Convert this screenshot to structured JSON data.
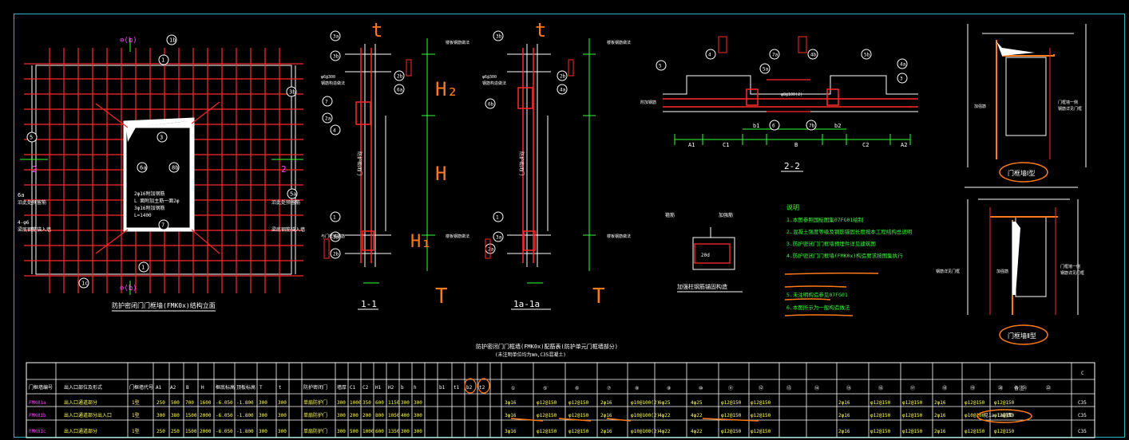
{
  "colors": {
    "background": "#000000",
    "frame": "#29b8c2",
    "rebar": "#ff2a2a",
    "dimension": "#33ff33",
    "highlight": "#ff7a1a",
    "label": "#ffffff",
    "magenta": "#ff44ff",
    "yellow": "#ffff55"
  },
  "elevation": {
    "title": "防护密闭门门框墙(FMK0x)结构立面",
    "labels": {
      "top": "1b",
      "left_mark": "5",
      "right_mark": "3b",
      "c1": "1",
      "c2": "3",
      "c3": "6a",
      "c4": "8b",
      "c5": "7",
      "c6": "4a",
      "c7": "4b",
      "c8": "5a",
      "c9": "7",
      "bottom": "1c"
    },
    "scale_top": "⊙(b)",
    "scale_bottom": "⊙(b)",
    "section_mark": "2",
    "notes": [
      "2φ16附加钢筋",
      "L 面附加主筋一面2φ",
      "3φ16附加钢筋",
      "L=1400"
    ],
    "side_notes": [
      "6a",
      "沿此处预留筋",
      "4-φ6",
      "梁底钢筋锚入墙"
    ]
  },
  "section11": {
    "title": "1-1",
    "handwritten": {
      "t": "t",
      "h2": "H₂",
      "h": "H",
      "h1": "H₁",
      "T": "T"
    },
    "labels": [
      "3a",
      "3b",
      "2b",
      "6a",
      "7",
      "2a",
      "4",
      "1",
      "3a",
      "2b"
    ],
    "notes": [
      "φ6@300",
      "钢筋构造做法",
      "与门框墙钢筋",
      "附加箍筋",
      "6a",
      "竖向钢筋",
      "纵向钢筋"
    ],
    "right_notes": [
      "楼板钢筋做法",
      "防护密闭门",
      "楼板钢筋做法"
    ]
  },
  "section1a": {
    "title": "1a-1a",
    "handwritten": {
      "t": "t",
      "T": "T"
    },
    "labels": [
      "3b",
      "2b",
      "4a",
      "6b",
      "1",
      "3a",
      "2a"
    ],
    "notes": [
      "φ6@300",
      "钢筋构造做法"
    ],
    "right_notes": [
      "楼板钢筋做法",
      "防护密闭门",
      "楼板钢筋做法"
    ]
  },
  "section22": {
    "title": "2-2",
    "labels": [
      "5",
      "4",
      "7a",
      "5a",
      "4b",
      "5b",
      "4a",
      "6",
      "7b",
      "3"
    ],
    "dims": [
      "A1",
      "C1",
      "b1",
      "B",
      "b2",
      "C2",
      "A2"
    ],
    "notes": [
      "φ8@100(2)",
      "附加钢筋"
    ]
  },
  "detail": {
    "title": "加强柱钢筋锚固构造",
    "labels": [
      "箍筋",
      "加强筋",
      "20d"
    ]
  },
  "notes": {
    "heading": "说明",
    "items": [
      "1.本图参照国标图集07FG01绘制",
      "2.混凝土强度等级及钢筋锚固长度按本工程结构总说明",
      "3.防护密闭门门框墙预埋件详见建筑图",
      "4.防护密闭门门框墙(FMK0x)构造要求按图集执行",
      "5.未注明构造参见07FG01",
      "6.本图所示为一般构造做法"
    ]
  },
  "types": {
    "type1": "门框墙Ⅰ型",
    "type2": "门框墙Ⅱ型",
    "labels": [
      "门框墙一侧",
      "钢筋详见门框",
      "加强筋"
    ]
  },
  "table": {
    "title": "防护密闭门门框墙(FMK0x)配筋表(防护单元门框墙部分)",
    "subtitle": "(未注明单位均为mm,C35混凝土)",
    "headers": [
      "门框墙编号",
      "出入口部位及形式",
      "门框墙代号",
      "A1",
      "A2",
      "B",
      "H",
      "框底标高",
      "顶板标高",
      "T",
      "t",
      "防护密闭门",
      "墙厚",
      "C1",
      "C2",
      "H1",
      "H2",
      "b",
      "h",
      "b1",
      "t1",
      "b2",
      "t2",
      "①",
      "⑤",
      "⑥",
      "⑦",
      "⑧",
      "⑨",
      "⑩",
      "⑪",
      "⑫",
      "⑬",
      "⑭",
      "⑮",
      "⑯",
      "⑰",
      "⑱",
      "⑲",
      "⑳",
      "㉑",
      "㉒",
      "备注",
      "C"
    ],
    "rows": [
      {
        "id": "FMK01a",
        "desc": "出入口通道部分",
        "code": "1型",
        "A1": "250",
        "A2": "500",
        "B": "700",
        "H": "1600",
        "bot": "-6.050",
        "top": "-1.800",
        "T": "300",
        "t": "300",
        "door": "单扇防护门",
        "w": "300",
        "C1": "1000",
        "C2": "350",
        "H1": "600",
        "H2": "1150",
        "b": "300",
        "h": "300",
        "r1": "3φ16",
        "r2": "φ12@150",
        "r3": "φ12@150",
        "r4": "2φ16",
        "r5": "φ10@100(2)",
        "r6": "6φ25",
        "r7": "4φ25",
        "r8": "φ12@150",
        "r9": "φ12@150",
        "r10": "2φ16",
        "r11": "φ12@150",
        "r12": "φ12@150",
        "r13": "2φ16",
        "r14": "φ12@150",
        "r15": "φ12@150",
        "note": "",
        "c": "C35"
      },
      {
        "id": "FMK01b",
        "desc": "出入口通道部分出入口",
        "code": "1型",
        "A1": "300",
        "A2": "380",
        "B": "1500",
        "H": "2000",
        "bot": "-6.050",
        "top": "-1.800",
        "T": "300",
        "t": "300",
        "door": "单扇防护门",
        "w": "300",
        "C1": "200",
        "C2": "200",
        "H1": "800",
        "H2": "1050",
        "b": "400",
        "h": "300",
        "r1": "3φ16",
        "r2": "φ12@150",
        "r3": "φ12@150",
        "r4": "2φ16",
        "r5": "φ10@100(2)",
        "r6": "4φ22",
        "r7": "4φ22",
        "r8": "φ12@150",
        "r9": "φ12@150",
        "r10": "2φ16",
        "r11": "φ12@150",
        "r12": "φ12@150",
        "r13": "2φ16",
        "r14": "φ10@100",
        "r15": "φ12@150",
        "note": "见1a-1a剖面",
        "c": "C35"
      },
      {
        "id": "FMK01c",
        "desc": "出入口通道部分",
        "code": "1型",
        "A1": "250",
        "A2": "250",
        "B": "1500",
        "H": "2000",
        "bot": "-6.050",
        "top": "-1.800",
        "T": "300",
        "t": "300",
        "door": "单扇防护门",
        "w": "300",
        "C1": "500",
        "C2": "1000",
        "H1": "600",
        "H2": "1350",
        "b": "300",
        "h": "300",
        "r1": "3φ16",
        "r2": "φ12@150",
        "r3": "φ12@150",
        "r4": "2φ16",
        "r5": "φ10@100(2)",
        "r6": "4φ22",
        "r7": "4φ22",
        "r8": "φ12@150",
        "r9": "φ12@150",
        "r10": "2φ16",
        "r11": "φ12@150",
        "r12": "φ12@150",
        "r13": "2φ16",
        "r14": "φ12@150",
        "r15": "φ12@150",
        "note": "",
        "c": "C35"
      }
    ]
  }
}
